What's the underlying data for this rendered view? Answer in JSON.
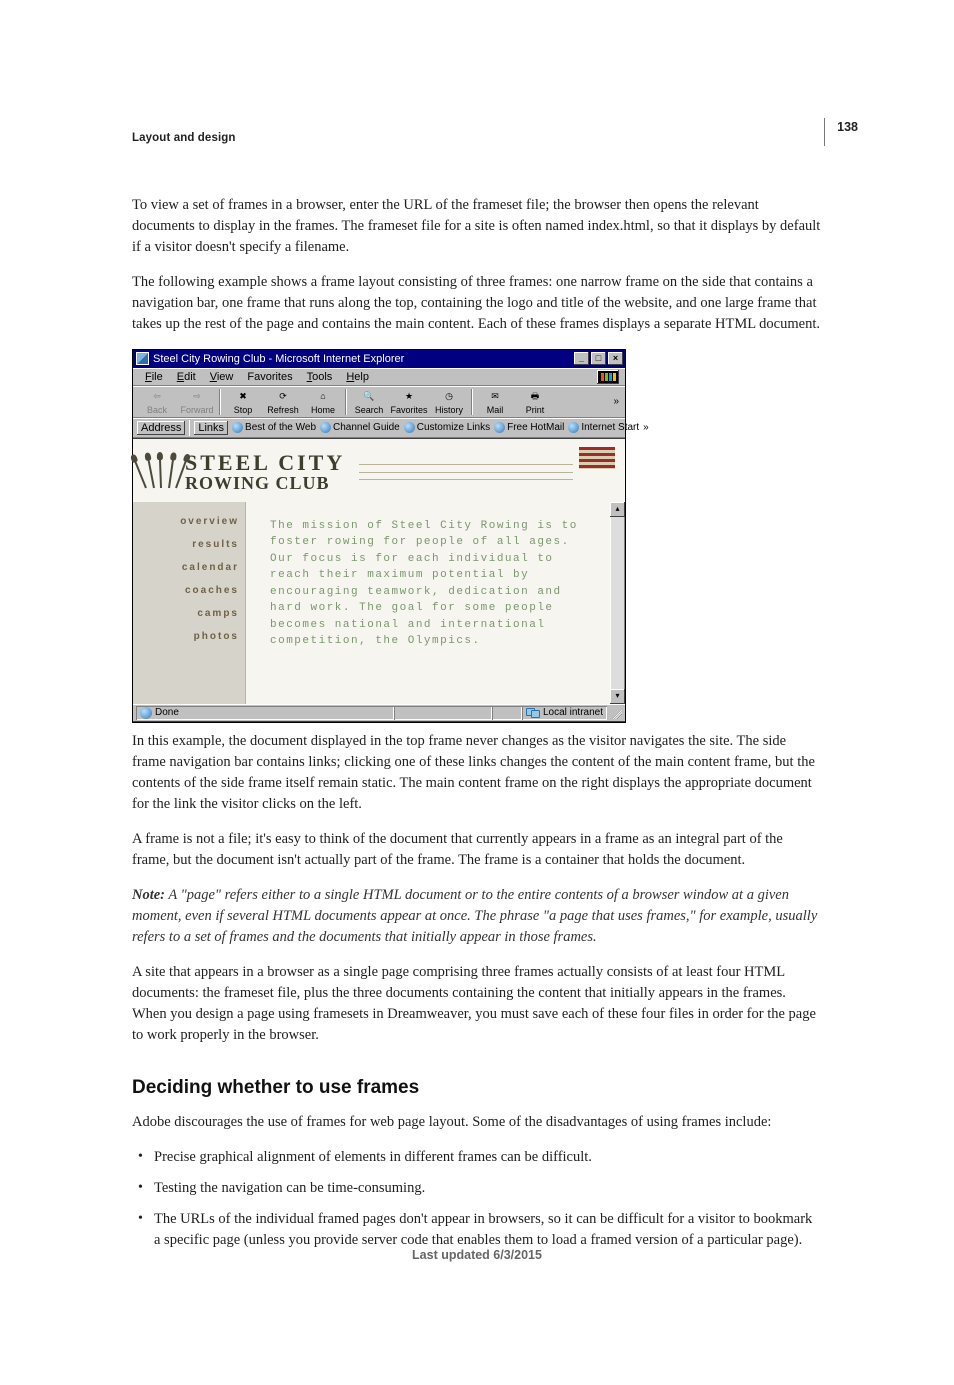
{
  "page_number": "138",
  "running_head": "Layout and design",
  "footer": "Last updated 6/3/2015",
  "para1": "To view a set of frames in a browser, enter the URL of the frameset file; the browser then opens the relevant documents to display in the frames. The frameset file for a site is often named index.html, so that it displays by default if a visitor doesn't specify a filename.",
  "para2": "The following example shows a frame layout consisting of three frames: one narrow frame on the side that contains a navigation bar, one frame that runs along the top, containing the logo and title of the website, and one large frame that takes up the rest of the page and contains the main content. Each of these frames displays a separate HTML document.",
  "para3": "In this example, the document displayed in the top frame never changes as the visitor navigates the site. The side frame navigation bar contains links; clicking one of these links changes the content of the main content frame, but the contents of the side frame itself remain static. The main content frame on the right displays the appropriate document for the link the visitor clicks on the left.",
  "para4": "A frame is not a file; it's easy to think of the document that currently appears in a frame as an integral part of the frame, but the document isn't actually part of the frame. The frame is a container that holds the document.",
  "note_label": "Note:",
  "note_body": " A \"page\" refers either to a single HTML document or to the entire contents of a browser window at a given moment, even if several HTML documents appear at once. The phrase \"a page that uses frames,\" for example, usually refers to a set of frames and the documents that initially appear in those frames.",
  "para5": "A site that appears in a browser as a single page comprising three frames actually consists of at least four HTML documents: the frameset file, plus the three documents containing the content that initially appears in the frames. When you design a page using framesets in Dreamweaver, you must save each of these four files in order for the page to work properly in the browser.",
  "h2": "Deciding whether to use frames",
  "para6": "Adobe discourages the use of frames for web page layout. Some of the disadvantages of using frames include:",
  "bullets": {
    "b1": "Precise graphical alignment of elements in different frames can be difficult.",
    "b2": "Testing the navigation can be time-consuming.",
    "b3": "The URLs of the individual framed pages don't appear in browsers, so it can be difficult for a visitor to bookmark a specific page (unless you provide server code that enables them to load a framed version of a particular page)."
  },
  "ie": {
    "title": "Steel City Rowing Club - Microsoft Internet Explorer",
    "menu": {
      "file": "File",
      "edit": "Edit",
      "view": "View",
      "favorites": "Favorites",
      "tools": "Tools",
      "help": "Help"
    },
    "tb": {
      "back": "Back",
      "forward": "Forward",
      "stop": "Stop",
      "refresh": "Refresh",
      "home": "Home",
      "search": "Search",
      "favorites": "Favorites",
      "history": "History",
      "mail": "Mail",
      "print": "Print"
    },
    "links": {
      "address": "Address",
      "links": "Links",
      "bow": "Best of the Web",
      "cg": "Channel Guide",
      "cl": "Customize Links",
      "fh": "Free HotMail",
      "is": "Internet Start"
    },
    "site": {
      "t1": "STEEL CITY",
      "t2": "ROWING CLUB",
      "nav": {
        "n1": "overview",
        "n2": "results",
        "n3": "calendar",
        "n4": "coaches",
        "n5": "camps",
        "n6": "photos"
      },
      "body": "The mission of Steel City Rowing is to foster rowing for people of all ages. Our focus is for each individual to reach their maximum potential by encouraging teamwork, dedication and hard work. The goal for some people becomes national and international competition, the Olympics."
    },
    "status": {
      "done": "Done",
      "zone": "Local intranet"
    }
  }
}
